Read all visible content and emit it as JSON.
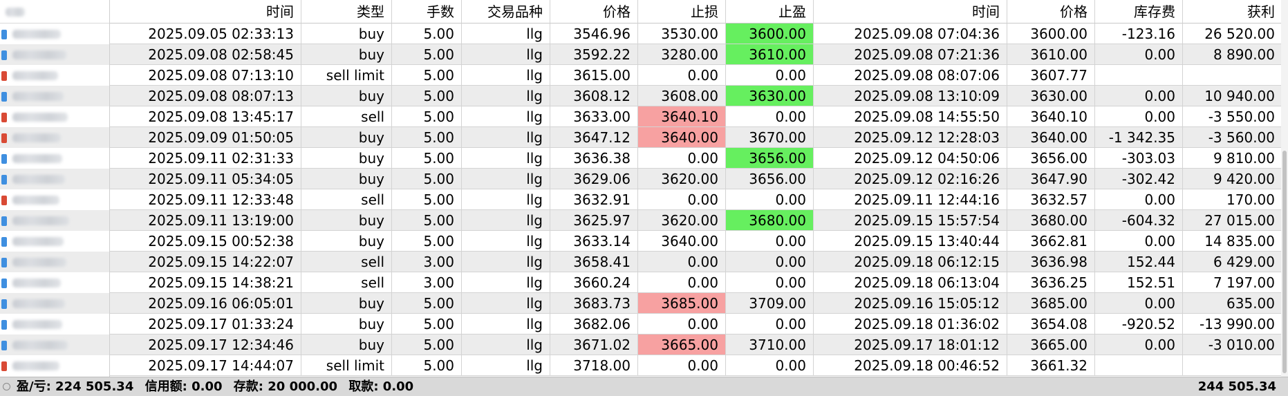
{
  "columns": {
    "open_time": "时间",
    "type": "类型",
    "volume": "手数",
    "symbol": "交易品种",
    "price": "价格",
    "sl": "止损",
    "tp": "止盈",
    "close_time": "时间",
    "close_price": "价格",
    "swap": "库存费",
    "profit": "获利"
  },
  "rows": [
    {
      "open_time": "2025.09.05 02:33:13",
      "type": "buy",
      "volume": "5.00",
      "symbol": "llg",
      "price": "3546.96",
      "sl": "3530.00",
      "tp": "3600.00",
      "close_time": "2025.09.08 07:04:36",
      "close_price": "3600.00",
      "swap": "-123.16",
      "profit": "26 520.00",
      "tp_hit": true,
      "sl_hit": false
    },
    {
      "open_time": "2025.09.08 02:58:45",
      "type": "buy",
      "volume": "5.00",
      "symbol": "llg",
      "price": "3592.22",
      "sl": "3280.00",
      "tp": "3610.00",
      "close_time": "2025.09.08 07:21:36",
      "close_price": "3610.00",
      "swap": "0.00",
      "profit": "8 890.00",
      "tp_hit": true,
      "sl_hit": false
    },
    {
      "open_time": "2025.09.08 07:13:10",
      "type": "sell limit",
      "volume": "5.00",
      "symbol": "llg",
      "price": "3615.00",
      "sl": "0.00",
      "tp": "0.00",
      "close_time": "2025.09.08 08:07:06",
      "close_price": "3607.77",
      "swap": "",
      "profit": "",
      "tp_hit": false,
      "sl_hit": false
    },
    {
      "open_time": "2025.09.08 08:07:13",
      "type": "buy",
      "volume": "5.00",
      "symbol": "llg",
      "price": "3608.12",
      "sl": "3608.00",
      "tp": "3630.00",
      "close_time": "2025.09.08 13:10:09",
      "close_price": "3630.00",
      "swap": "0.00",
      "profit": "10 940.00",
      "tp_hit": true,
      "sl_hit": false
    },
    {
      "open_time": "2025.09.08 13:45:17",
      "type": "sell",
      "volume": "5.00",
      "symbol": "llg",
      "price": "3633.00",
      "sl": "3640.10",
      "tp": "0.00",
      "close_time": "2025.09.08 14:55:50",
      "close_price": "3640.10",
      "swap": "0.00",
      "profit": "-3 550.00",
      "tp_hit": false,
      "sl_hit": true
    },
    {
      "open_time": "2025.09.09 01:50:05",
      "type": "buy",
      "volume": "5.00",
      "symbol": "llg",
      "price": "3647.12",
      "sl": "3640.00",
      "tp": "3670.00",
      "close_time": "2025.09.12 12:28:03",
      "close_price": "3640.00",
      "swap": "-1 342.35",
      "profit": "-3 560.00",
      "tp_hit": false,
      "sl_hit": true
    },
    {
      "open_time": "2025.09.11 02:31:33",
      "type": "buy",
      "volume": "5.00",
      "symbol": "llg",
      "price": "3636.38",
      "sl": "0.00",
      "tp": "3656.00",
      "close_time": "2025.09.12 04:50:06",
      "close_price": "3656.00",
      "swap": "-303.03",
      "profit": "9 810.00",
      "tp_hit": true,
      "sl_hit": false
    },
    {
      "open_time": "2025.09.11 05:34:05",
      "type": "buy",
      "volume": "5.00",
      "symbol": "llg",
      "price": "3629.06",
      "sl": "3620.00",
      "tp": "3656.00",
      "close_time": "2025.09.12 02:16:26",
      "close_price": "3647.90",
      "swap": "-302.42",
      "profit": "9 420.00",
      "tp_hit": false,
      "sl_hit": false
    },
    {
      "open_time": "2025.09.11 12:33:48",
      "type": "sell",
      "volume": "5.00",
      "symbol": "llg",
      "price": "3632.91",
      "sl": "0.00",
      "tp": "0.00",
      "close_time": "2025.09.11 12:44:16",
      "close_price": "3632.57",
      "swap": "0.00",
      "profit": "170.00",
      "tp_hit": false,
      "sl_hit": false
    },
    {
      "open_time": "2025.09.11 13:19:00",
      "type": "buy",
      "volume": "5.00",
      "symbol": "llg",
      "price": "3625.97",
      "sl": "3620.00",
      "tp": "3680.00",
      "close_time": "2025.09.15 15:57:54",
      "close_price": "3680.00",
      "swap": "-604.32",
      "profit": "27 015.00",
      "tp_hit": true,
      "sl_hit": false
    },
    {
      "open_time": "2025.09.15 00:52:38",
      "type": "buy",
      "volume": "5.00",
      "symbol": "llg",
      "price": "3633.14",
      "sl": "3640.00",
      "tp": "0.00",
      "close_time": "2025.09.15 13:40:44",
      "close_price": "3662.81",
      "swap": "0.00",
      "profit": "14 835.00",
      "tp_hit": false,
      "sl_hit": false
    },
    {
      "open_time": "2025.09.15 14:22:07",
      "type": "sell",
      "volume": "3.00",
      "symbol": "llg",
      "price": "3658.41",
      "sl": "0.00",
      "tp": "0.00",
      "close_time": "2025.09.18 06:12:15",
      "close_price": "3636.98",
      "swap": "152.44",
      "profit": "6 429.00",
      "tp_hit": false,
      "sl_hit": false
    },
    {
      "open_time": "2025.09.15 14:38:21",
      "type": "sell",
      "volume": "3.00",
      "symbol": "llg",
      "price": "3660.24",
      "sl": "0.00",
      "tp": "0.00",
      "close_time": "2025.09.18 06:13:04",
      "close_price": "3636.25",
      "swap": "152.51",
      "profit": "7 197.00",
      "tp_hit": false,
      "sl_hit": false
    },
    {
      "open_time": "2025.09.16 06:05:01",
      "type": "buy",
      "volume": "5.00",
      "symbol": "llg",
      "price": "3683.73",
      "sl": "3685.00",
      "tp": "3709.00",
      "close_time": "2025.09.16 15:05:12",
      "close_price": "3685.00",
      "swap": "0.00",
      "profit": "635.00",
      "tp_hit": false,
      "sl_hit": true
    },
    {
      "open_time": "2025.09.17 01:33:24",
      "type": "buy",
      "volume": "5.00",
      "symbol": "llg",
      "price": "3682.06",
      "sl": "0.00",
      "tp": "0.00",
      "close_time": "2025.09.18 01:36:02",
      "close_price": "3654.08",
      "swap": "-920.52",
      "profit": "-13 990.00",
      "tp_hit": false,
      "sl_hit": false
    },
    {
      "open_time": "2025.09.17 12:34:46",
      "type": "buy",
      "volume": "5.00",
      "symbol": "llg",
      "price": "3671.02",
      "sl": "3665.00",
      "tp": "3710.00",
      "close_time": "2025.09.17 18:01:12",
      "close_price": "3665.00",
      "swap": "0.00",
      "profit": "-3 010.00",
      "tp_hit": false,
      "sl_hit": true
    },
    {
      "open_time": "2025.09.17 14:44:07",
      "type": "sell limit",
      "volume": "5.00",
      "symbol": "llg",
      "price": "3718.00",
      "sl": "0.00",
      "tp": "0.00",
      "close_time": "2025.09.18 00:46:52",
      "close_price": "3661.32",
      "swap": "",
      "profit": "",
      "tp_hit": false,
      "sl_hit": false
    }
  ],
  "side_icons": [
    "blue",
    "blue",
    "red",
    "blue",
    "red",
    "red",
    "blue",
    "blue",
    "red",
    "blue",
    "blue",
    "blue",
    "blue",
    "blue",
    "blue",
    "blue",
    "red"
  ],
  "footer": {
    "pl": "盈/亏: 224 505.34",
    "credit": "信用额: 0.00",
    "deposit": "存款: 20 000.00",
    "withdrawal": "取款: 0.00",
    "total": "244 505.34"
  },
  "colors": {
    "tp_hit": "#66ef5f",
    "sl_hit": "#f7a1a1",
    "alt_row": "#ececec",
    "footer_bg": "#d9d9d9"
  }
}
